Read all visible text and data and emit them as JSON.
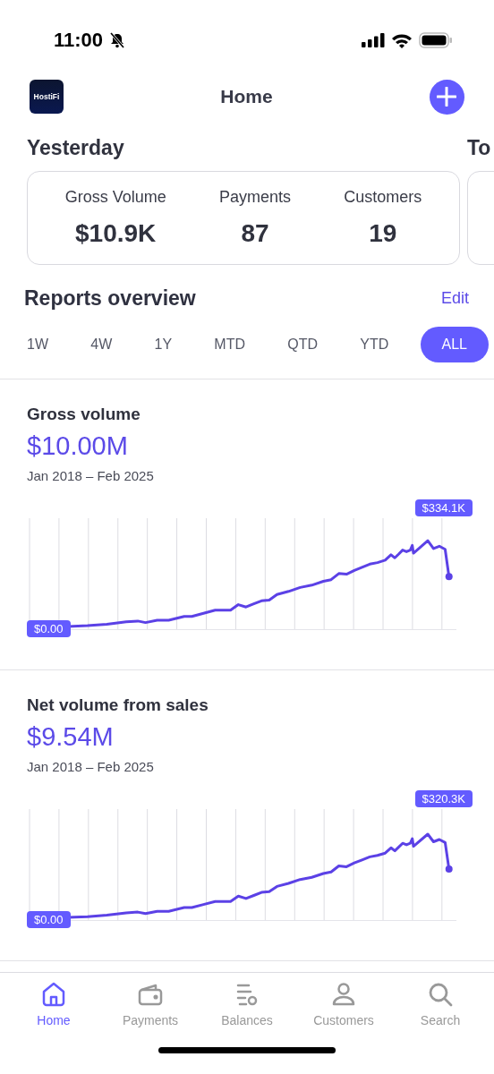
{
  "status_bar": {
    "time": "11:00"
  },
  "header": {
    "logo_text": "HostiFi",
    "title": "Home"
  },
  "summary_cards": [
    {
      "heading": "Yesterday",
      "metrics": [
        {
          "label": "Gross Volume",
          "value": "$10.9K"
        },
        {
          "label": "Payments",
          "value": "87"
        },
        {
          "label": "Customers",
          "value": "19"
        }
      ]
    },
    {
      "heading": "To"
    }
  ],
  "reports": {
    "title": "Reports overview",
    "edit_link": "Edit",
    "periods": [
      {
        "label": "1W",
        "selected": false
      },
      {
        "label": "4W",
        "selected": false
      },
      {
        "label": "1Y",
        "selected": false
      },
      {
        "label": "MTD",
        "selected": false
      },
      {
        "label": "QTD",
        "selected": false
      },
      {
        "label": "YTD",
        "selected": false
      },
      {
        "label": "ALL",
        "selected": true
      }
    ],
    "charts": [
      {
        "title": "Gross volume",
        "value": "$10.00M",
        "date_range": "Jan 2018 – Feb 2025",
        "max_label": "$334.1K",
        "min_label": "$0.00"
      },
      {
        "title": "Net volume from sales",
        "value": "$9.54M",
        "date_range": "Jan 2018 – Feb 2025",
        "max_label": "$320.3K",
        "min_label": "$0.00"
      }
    ]
  },
  "tab_bar": [
    {
      "label": "Home",
      "kind": "home",
      "selected": true
    },
    {
      "label": "Payments",
      "kind": "wallet",
      "selected": false
    },
    {
      "label": "Balances",
      "kind": "balances",
      "selected": false
    },
    {
      "label": "Customers",
      "kind": "person",
      "selected": false
    },
    {
      "label": "Search",
      "kind": "search",
      "selected": false
    }
  ]
}
